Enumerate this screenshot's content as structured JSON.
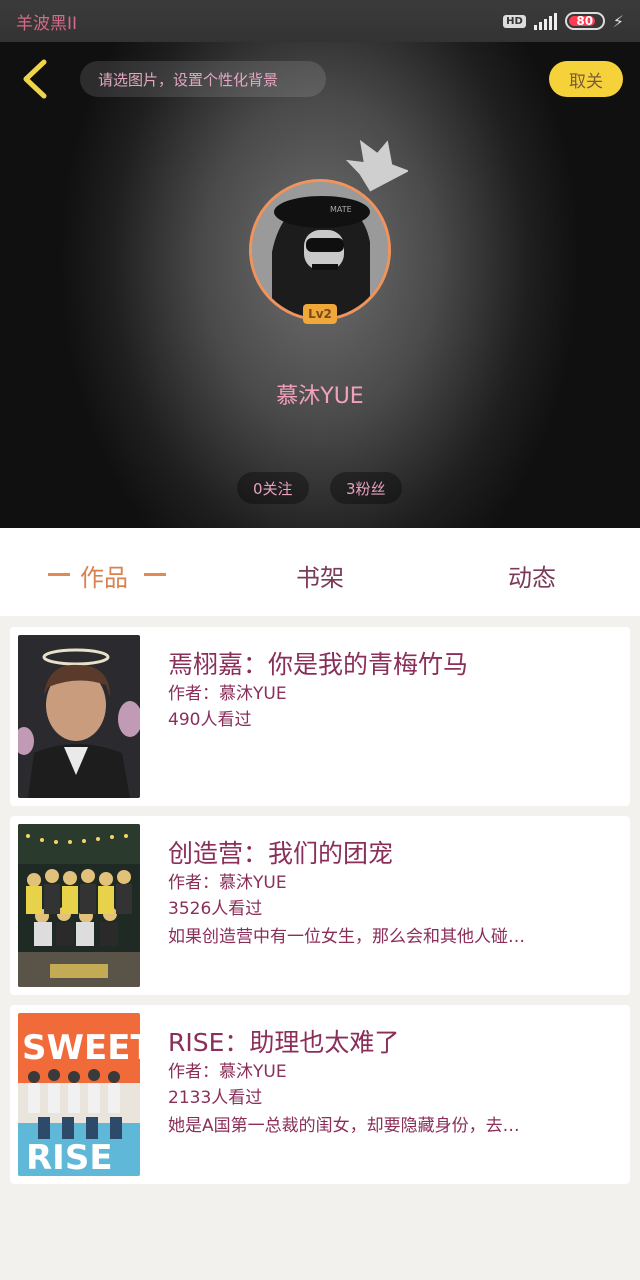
{
  "status_bar": {
    "carrier": "羊波黑II",
    "hd": "HD",
    "battery": "80"
  },
  "header": {
    "search_placeholder": "请选图片，设置个性化背景",
    "cancel_label": "取关"
  },
  "profile": {
    "level": "Lv2",
    "username": "慕沐YUE",
    "following": "0关注",
    "fans": "3粉丝"
  },
  "tabs": [
    {
      "label": "作品",
      "active": true
    },
    {
      "label": "书架",
      "active": false
    },
    {
      "label": "动态",
      "active": false
    }
  ],
  "works": [
    {
      "title": "焉栩嘉：你是我的青梅竹马",
      "author": "作者：慕沐YUE",
      "views": "490人看过",
      "desc": ""
    },
    {
      "title": "创造营：我们的团宠",
      "author": "作者：慕沐YUE",
      "views": "3526人看过",
      "desc": "如果创造营中有一位女生，那么会和其他人碰…"
    },
    {
      "title": "RISE：助理也太难了",
      "author": "作者：慕沐YUE",
      "views": "2133人看过",
      "desc": "她是A国第一总裁的闺女，却要隐藏身份，去…"
    }
  ],
  "colors": {
    "accent_orange": "#d9814f",
    "text_magenta": "#8a2e5a",
    "cancel_yellow": "#f5d23a"
  }
}
